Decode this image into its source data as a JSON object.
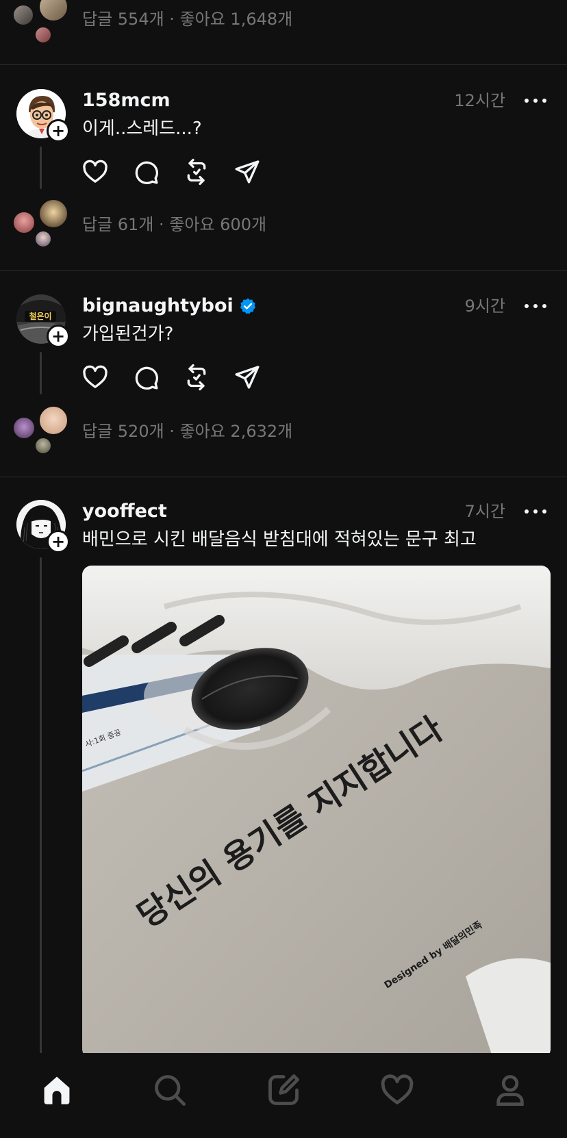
{
  "feed": {
    "top_stats": "답글 554개 · 좋아요 1,648개",
    "posts": [
      {
        "username": "158mcm",
        "time": "12시간",
        "text": "이게..스레드...?",
        "verified": false,
        "stats": "답글 61개 · 좋아요 600개"
      },
      {
        "username": "bignaughtyboi",
        "time": "9시간",
        "text": "가입된건가?",
        "verified": true,
        "avatar_label": "철은이",
        "stats": "답글 520개 · 좋아요 2,632개"
      },
      {
        "username": "yooffect",
        "time": "7시간",
        "text": "배민으로 시킨 배달음식 받침대에 적혀있는 문구 최고",
        "verified": false,
        "photo": {
          "caption_main": "당신의 용기를 지지합니다",
          "caption_credit": "Designed by 배달의민족",
          "box_label": "사:1회 중공"
        }
      }
    ]
  },
  "icons": {
    "like": "heart-icon",
    "reply": "comment-icon",
    "repost": "repost-icon",
    "share": "send-icon",
    "more": "more-icon"
  },
  "bottom_nav": {
    "items": [
      "home-icon",
      "search-icon",
      "compose-icon",
      "activity-icon",
      "profile-icon"
    ],
    "active": "home-icon"
  },
  "colors": {
    "background": "#101010",
    "primary_text": "#f3f5f7",
    "secondary_text": "#777777",
    "divider": "#2a2a2a",
    "verified": "#0095f6"
  }
}
